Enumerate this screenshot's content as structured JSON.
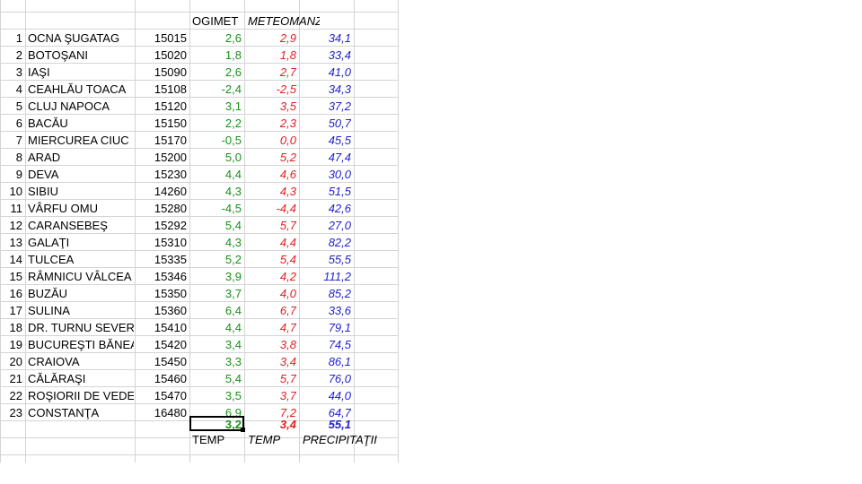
{
  "headers": {
    "ogimet": "OGIMET",
    "meteomanz": "METEOMANZ"
  },
  "rows": [
    {
      "n": "1",
      "city": "OCNA ŞUGATAG",
      "code": "15015",
      "ogimet": "2,6",
      "meteo": "2,9",
      "precip": "34,1"
    },
    {
      "n": "2",
      "city": "BOTOŞANI",
      "code": "15020",
      "ogimet": "1,8",
      "meteo": "1,8",
      "precip": "33,4"
    },
    {
      "n": "3",
      "city": "IAŞI",
      "code": "15090",
      "ogimet": "2,6",
      "meteo": "2,7",
      "precip": "41,0"
    },
    {
      "n": "4",
      "city": "CEAHLĂU TOACA",
      "code": "15108",
      "ogimet": "-2,4",
      "meteo": "-2,5",
      "precip": "34,3"
    },
    {
      "n": "5",
      "city": "CLUJ NAPOCA",
      "code": "15120",
      "ogimet": "3,1",
      "meteo": "3,5",
      "precip": "37,2"
    },
    {
      "n": "6",
      "city": "BACĂU",
      "code": "15150",
      "ogimet": "2,2",
      "meteo": "2,3",
      "precip": "50,7"
    },
    {
      "n": "7",
      "city": "MIERCUREA CIUC",
      "code": "15170",
      "ogimet": "-0,5",
      "meteo": "0,0",
      "precip": "45,5"
    },
    {
      "n": "8",
      "city": "ARAD",
      "code": "15200",
      "ogimet": "5,0",
      "meteo": "5,2",
      "precip": "47,4"
    },
    {
      "n": "9",
      "city": "DEVA",
      "code": "15230",
      "ogimet": "4,4",
      "meteo": "4,6",
      "precip": "30,0"
    },
    {
      "n": "10",
      "city": "SIBIU",
      "code": "14260",
      "ogimet": "4,3",
      "meteo": "4,3",
      "precip": "51,5"
    },
    {
      "n": "11",
      "city": "VÂRFU OMU",
      "code": "15280",
      "ogimet": "-4,5",
      "meteo": "-4,4",
      "precip": "42,6"
    },
    {
      "n": "12",
      "city": "CARANSEBEŞ",
      "code": "15292",
      "ogimet": "5,4",
      "meteo": "5,7",
      "precip": "27,0"
    },
    {
      "n": "13",
      "city": "GALAŢI",
      "code": "15310",
      "ogimet": "4,3",
      "meteo": "4,4",
      "precip": "82,2"
    },
    {
      "n": "14",
      "city": "TULCEA",
      "code": "15335",
      "ogimet": "5,2",
      "meteo": "5,4",
      "precip": "55,5"
    },
    {
      "n": "15",
      "city": "RÂMNICU VÂLCEA",
      "code": "15346",
      "ogimet": "3,9",
      "meteo": "4,2",
      "precip": "111,2"
    },
    {
      "n": "16",
      "city": "BUZĂU",
      "code": "15350",
      "ogimet": "3,7",
      "meteo": "4,0",
      "precip": "85,2"
    },
    {
      "n": "17",
      "city": "SULINA",
      "code": "15360",
      "ogimet": "6,4",
      "meteo": "6,7",
      "precip": "33,6"
    },
    {
      "n": "18",
      "city": "DR. TURNU SEVER",
      "code": "15410",
      "ogimet": "4,4",
      "meteo": "4,7",
      "precip": "79,1"
    },
    {
      "n": "19",
      "city": "BUCUREŞTI BĂNEA",
      "code": "15420",
      "ogimet": "3,4",
      "meteo": "3,8",
      "precip": "74,5"
    },
    {
      "n": "20",
      "city": "CRAIOVA",
      "code": "15450",
      "ogimet": "3,3",
      "meteo": "3,4",
      "precip": "86,1"
    },
    {
      "n": "21",
      "city": "CĂLĂRAŞI",
      "code": "15460",
      "ogimet": "5,4",
      "meteo": "5,7",
      "precip": "76,0"
    },
    {
      "n": "22",
      "city": "ROŞIORII DE VEDE",
      "code": "15470",
      "ogimet": "3,5",
      "meteo": "3,7",
      "precip": "44,0"
    },
    {
      "n": "23",
      "city": "CONSTANŢA",
      "code": "16480",
      "ogimet": "6,9",
      "meteo": "7,2",
      "precip": "64,7"
    }
  ],
  "totals": {
    "ogimet": "3,2",
    "meteo": "3,4",
    "precip": "55,1"
  },
  "footer": {
    "temp1": "TEMP",
    "temp2": "TEMP",
    "precip": "PRECIPITAŢII"
  },
  "colors": {
    "green": "#1a8f1a",
    "red": "#e31e1e",
    "blue": "#2222cc",
    "grid": "#d4d4d4"
  }
}
